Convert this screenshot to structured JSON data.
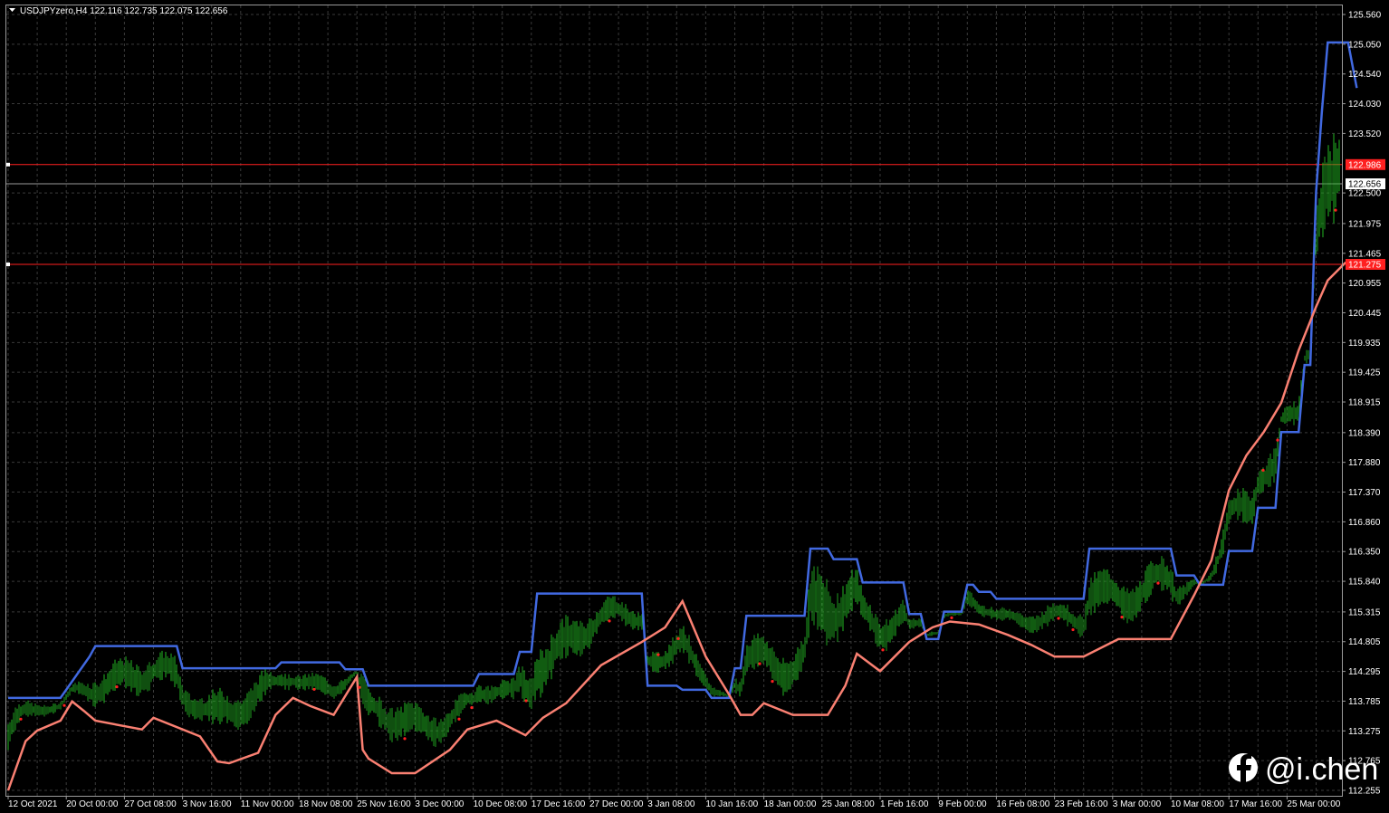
{
  "title": "USDJPYzero,H4  122.116 122.735 122.075 122.656",
  "watermark": "@i.chen",
  "colors": {
    "background": "#000000",
    "grid": "#3a3a3a",
    "frame": "#9a9a9a",
    "upper_line": "#4169e1",
    "lower_line": "#fa8072",
    "price_up": "#22b822",
    "price_down": "#1f9e1f",
    "arrow_dots": "#ff2020",
    "hline": "#ff2020",
    "current_price_line": "#9a9a9a",
    "text": "#ffffff"
  },
  "chart_data": {
    "type": "line",
    "symbol": "USDJPYzero",
    "timeframe": "H4",
    "ohlc_header": {
      "open": 122.116,
      "high": 122.735,
      "low": 122.075,
      "close": 122.656
    },
    "ylim": [
      112.255,
      125.56
    ],
    "y_ticks": [
      "125.560",
      "125.050",
      "124.540",
      "124.030",
      "123.520",
      "122.500",
      "121.975",
      "121.465",
      "120.955",
      "120.445",
      "119.935",
      "119.425",
      "118.915",
      "118.390",
      "117.880",
      "117.370",
      "116.860",
      "116.350",
      "115.840",
      "115.315",
      "114.805",
      "114.295",
      "113.785",
      "113.275",
      "112.765",
      "112.255"
    ],
    "x_labels": [
      "12 Oct 2021",
      "20 Oct 00:00",
      "27 Oct 08:00",
      "3 Nov 16:00",
      "11 Nov 00:00",
      "18 Nov 08:00",
      "25 Nov 16:00",
      "3 Dec 00:00",
      "10 Dec 08:00",
      "17 Dec 16:00",
      "27 Dec 00:00",
      "3 Jan 08:00",
      "10 Jan 16:00",
      "18 Jan 00:00",
      "25 Jan 08:00",
      "1 Feb 16:00",
      "9 Feb 00:00",
      "16 Feb 08:00",
      "23 Feb 16:00",
      "3 Mar 00:00",
      "10 Mar 08:00",
      "17 Mar 16:00",
      "25 Mar 00:00"
    ],
    "horizontal_lines": [
      {
        "value": 122.986,
        "label": "122.986"
      },
      {
        "value": 121.275,
        "label": "121.275"
      }
    ],
    "current_price": {
      "value": 122.656,
      "label": "122.656"
    },
    "series": [
      {
        "key": "upper",
        "x": [
          0,
          0.9,
          1.4,
          1.5,
          2.9,
          3.0,
          4.6,
          4.7,
          5.7,
          5.8,
          6.1,
          6.2,
          8.0,
          8.1,
          8.7,
          8.8,
          9.0,
          9.1,
          10.9,
          11.0,
          11.5,
          11.6,
          12.0,
          12.1,
          12.4,
          12.5,
          12.6,
          12.7,
          13.7,
          13.8,
          14.1,
          14.2,
          14.6,
          14.7,
          15.4,
          15.5,
          15.7,
          15.8,
          16.0,
          16.1,
          16.4,
          16.5,
          16.6,
          16.7,
          16.9,
          17.0,
          18.5,
          18.6,
          20.0,
          20.1,
          20.4,
          20.5,
          20.9,
          21.0,
          21.4,
          21.5,
          21.8,
          21.9,
          22.2,
          22.3,
          22.4,
          22.5
        ],
        "values": [
          113.84,
          113.84,
          114.55,
          114.73,
          114.73,
          114.35,
          114.35,
          114.45,
          114.45,
          114.33,
          114.33,
          114.05,
          114.05,
          114.25,
          114.25,
          114.63,
          114.63,
          115.63,
          115.63,
          114.05,
          114.05,
          113.98,
          113.98,
          113.84,
          113.84,
          114.35,
          114.35,
          115.25,
          115.25,
          116.4,
          116.4,
          116.22,
          116.22,
          115.82,
          115.82,
          115.28,
          115.28,
          114.85,
          114.85,
          115.32,
          115.32,
          115.78,
          115.78,
          115.66,
          115.66,
          115.54,
          115.54,
          116.4,
          116.4,
          115.94,
          115.94,
          115.78,
          115.78,
          116.36,
          116.36,
          117.1,
          117.1,
          118.4,
          118.4,
          119.55,
          119.55,
          122.52
        ],
        "upper_tail": {
          "x": [
            22.6,
            22.7,
            22.9,
            23.05,
            23.2
          ],
          "values": [
            123.9,
            125.08,
            125.08,
            125.08,
            124.3
          ]
        }
      },
      {
        "key": "lower",
        "x": [
          0,
          0.3,
          0.5,
          0.9,
          1.1,
          1.3,
          1.5,
          2.3,
          2.5,
          3.3,
          3.6,
          3.8,
          4.3,
          4.6,
          4.9,
          5.2,
          5.6,
          6.0,
          6.1,
          6.2,
          6.6,
          7.0,
          7.6,
          7.9,
          8.4,
          8.9,
          9.2,
          9.6,
          10.2,
          10.9,
          11.3,
          11.6,
          12.0,
          12.4,
          12.6,
          12.8,
          13.0,
          13.5,
          13.8,
          14.1,
          14.4,
          14.6,
          15.0,
          15.5,
          15.9,
          16.2,
          16.7,
          17.2,
          17.6,
          18.0,
          18.5,
          19.1,
          19.7,
          20.0,
          20.4,
          20.7,
          21.0,
          21.3,
          21.6,
          21.9,
          22.2,
          22.5,
          22.7,
          23.0,
          23.2
        ],
        "values": [
          112.255,
          113.1,
          113.28,
          113.45,
          113.78,
          113.62,
          113.45,
          113.3,
          113.5,
          113.18,
          112.75,
          112.72,
          112.9,
          113.55,
          113.84,
          113.7,
          113.55,
          114.2,
          112.95,
          112.8,
          112.55,
          112.55,
          112.95,
          113.3,
          113.45,
          113.2,
          113.5,
          113.75,
          114.4,
          114.8,
          115.05,
          115.5,
          114.55,
          113.9,
          113.55,
          113.55,
          113.75,
          113.55,
          113.55,
          113.55,
          114.05,
          114.6,
          114.3,
          114.8,
          115.05,
          115.15,
          115.1,
          114.92,
          114.75,
          114.55,
          114.55,
          114.85,
          114.85,
          114.85,
          115.6,
          116.2,
          117.4,
          118.0,
          118.4,
          118.9,
          119.8,
          120.55,
          121.0,
          121.3,
          121.28
        ]
      }
    ]
  }
}
